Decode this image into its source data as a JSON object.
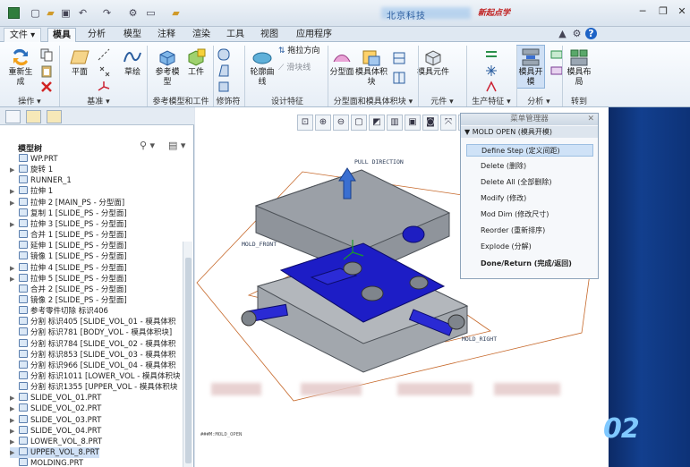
{
  "titlebar": {
    "app_title": "北京科技",
    "brand": "新起点学",
    "quick_access": [
      "new-icon",
      "open-icon",
      "save-icon",
      "undo-icon",
      "redo-icon",
      "regenerate-icon",
      "window-icon",
      "folder-icon"
    ],
    "window_controls": [
      "minimize-icon",
      "restore-icon",
      "close-icon"
    ]
  },
  "tabs": {
    "file": "文件",
    "items": [
      "模具",
      "分析",
      "模型",
      "注释",
      "渲染",
      "工具",
      "视图",
      "应用程序"
    ],
    "active": "模具"
  },
  "ribbon": {
    "buttons": {
      "regenerate": "重新生成",
      "plane": "平面",
      "sketch": "草绘",
      "ref_model": "参考模型",
      "workpiece": "工件",
      "runner_curve": "轮廓曲线",
      "pull_dir": "拖拉方向",
      "slide_line": "滑块线",
      "parting_surface": "分型面",
      "mold_volume": "模具体积块",
      "mold_component": "模具元件",
      "mold_open": "模具开模",
      "mold_layout": "模具布局"
    },
    "groups": {
      "operation": "操作",
      "datum": "基准",
      "ref_model_workpiece": "参考模型和工件",
      "modifier": "修饰符",
      "design_feature": "设计特征",
      "parting_volume": "分型面和模具体积块",
      "component": "元件",
      "manufacturing": "生产特征",
      "analysis": "分析",
      "goto": "转到"
    }
  },
  "model_tree": {
    "title": "模型树",
    "rows": [
      {
        "exp": "",
        "label": "WP.PRT"
      },
      {
        "exp": "▶",
        "label": "旋转 1"
      },
      {
        "exp": "",
        "label": "RUNNER_1"
      },
      {
        "exp": "▶",
        "label": "拉伸 1"
      },
      {
        "exp": "▶",
        "label": "拉伸 2 [MAIN_PS - 分型面]"
      },
      {
        "exp": "",
        "label": "复制 1 [SLIDE_PS - 分型面]"
      },
      {
        "exp": "▶",
        "label": "拉伸 3 [SLIDE_PS - 分型面]"
      },
      {
        "exp": "",
        "label": "合并 1 [SLIDE_PS - 分型面]"
      },
      {
        "exp": "",
        "label": "延伸 1 [SLIDE_PS - 分型面]"
      },
      {
        "exp": "",
        "label": "镜像 1 [SLIDE_PS - 分型面]"
      },
      {
        "exp": "▶",
        "label": "拉伸 4 [SLIDE_PS - 分型面]"
      },
      {
        "exp": "▶",
        "label": "拉伸 5 [SLIDE_PS - 分型面]"
      },
      {
        "exp": "",
        "label": "合并 2 [SLIDE_PS - 分型面]"
      },
      {
        "exp": "",
        "label": "镜像 2 [SLIDE_PS - 分型面]"
      },
      {
        "exp": "",
        "label": "参考零件切除 标识406"
      },
      {
        "exp": "",
        "label": "分割 标识405 [SLIDE_VOL_01 - 模具体积"
      },
      {
        "exp": "",
        "label": "分割 标识781 [BODY_VOL - 模具体积块]"
      },
      {
        "exp": "",
        "label": "分割 标识784 [SLIDE_VOL_02 - 模具体积"
      },
      {
        "exp": "",
        "label": "分割 标识853 [SLIDE_VOL_03 - 模具体积"
      },
      {
        "exp": "",
        "label": "分割 标识966 [SLIDE_VOL_04 - 模具体积"
      },
      {
        "exp": "",
        "label": "分割 标识1011 [LOWER_VOL - 模具体积块"
      },
      {
        "exp": "",
        "label": "分割 标识1355 [UPPER_VOL - 模具体积块"
      },
      {
        "exp": "▶",
        "label": "SLIDE_VOL_01.PRT"
      },
      {
        "exp": "▶",
        "label": "SLIDE_VOL_02.PRT"
      },
      {
        "exp": "▶",
        "label": "SLIDE_VOL_03.PRT"
      },
      {
        "exp": "▶",
        "label": "SLIDE_VOL_04.PRT"
      },
      {
        "exp": "▶",
        "label": "LOWER_VOL_8.PRT"
      },
      {
        "exp": "▶",
        "label": "UPPER_VOL_8.PRT"
      },
      {
        "exp": "",
        "label": "MOLDING.PRT"
      }
    ]
  },
  "graphics": {
    "pull_direction": "PULL DIRECTION",
    "mold_front": "MOLD_FRONT",
    "mold_right": "MOLD_RIGHT",
    "status_note": "###M:MOLD_OPEN"
  },
  "mold_manager": {
    "title": "菜单管理器",
    "subtitle": "▼ MOLD OPEN (模具开模)",
    "items": [
      "Define Step (定义间距)",
      "Delete (删除)",
      "Delete All (全部删除)",
      "Modify (修改)",
      "Mod Dim (修改尺寸)",
      "Reorder (重新排序)",
      "Explode (分解)",
      "Done/Return (完成/返回)"
    ]
  },
  "deco_number": "02",
  "colors": {
    "accent": "#2a5d9f",
    "part_gray": "#8a8f97",
    "slide_blue": "#2222cc",
    "datum_orange": "#c6682a"
  }
}
